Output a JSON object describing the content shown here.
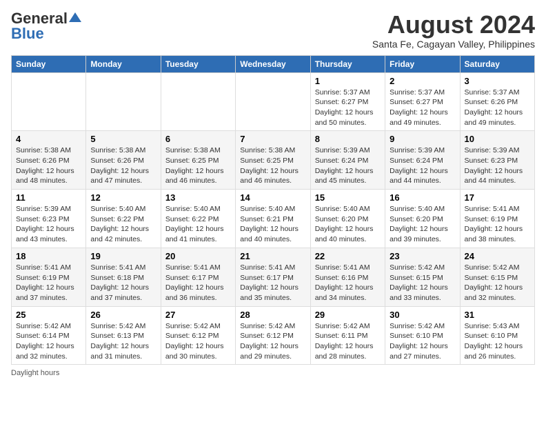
{
  "header": {
    "logo_general": "General",
    "logo_blue": "Blue",
    "month_title": "August 2024",
    "location": "Santa Fe, Cagayan Valley, Philippines"
  },
  "days_of_week": [
    "Sunday",
    "Monday",
    "Tuesday",
    "Wednesday",
    "Thursday",
    "Friday",
    "Saturday"
  ],
  "footer": {
    "daylight_hours": "Daylight hours"
  },
  "weeks": [
    [
      {
        "day": "",
        "info": ""
      },
      {
        "day": "",
        "info": ""
      },
      {
        "day": "",
        "info": ""
      },
      {
        "day": "",
        "info": ""
      },
      {
        "day": "1",
        "info": "Sunrise: 5:37 AM\nSunset: 6:27 PM\nDaylight: 12 hours\nand 50 minutes."
      },
      {
        "day": "2",
        "info": "Sunrise: 5:37 AM\nSunset: 6:27 PM\nDaylight: 12 hours\nand 49 minutes."
      },
      {
        "day": "3",
        "info": "Sunrise: 5:37 AM\nSunset: 6:26 PM\nDaylight: 12 hours\nand 49 minutes."
      }
    ],
    [
      {
        "day": "4",
        "info": "Sunrise: 5:38 AM\nSunset: 6:26 PM\nDaylight: 12 hours\nand 48 minutes."
      },
      {
        "day": "5",
        "info": "Sunrise: 5:38 AM\nSunset: 6:26 PM\nDaylight: 12 hours\nand 47 minutes."
      },
      {
        "day": "6",
        "info": "Sunrise: 5:38 AM\nSunset: 6:25 PM\nDaylight: 12 hours\nand 46 minutes."
      },
      {
        "day": "7",
        "info": "Sunrise: 5:38 AM\nSunset: 6:25 PM\nDaylight: 12 hours\nand 46 minutes."
      },
      {
        "day": "8",
        "info": "Sunrise: 5:39 AM\nSunset: 6:24 PM\nDaylight: 12 hours\nand 45 minutes."
      },
      {
        "day": "9",
        "info": "Sunrise: 5:39 AM\nSunset: 6:24 PM\nDaylight: 12 hours\nand 44 minutes."
      },
      {
        "day": "10",
        "info": "Sunrise: 5:39 AM\nSunset: 6:23 PM\nDaylight: 12 hours\nand 44 minutes."
      }
    ],
    [
      {
        "day": "11",
        "info": "Sunrise: 5:39 AM\nSunset: 6:23 PM\nDaylight: 12 hours\nand 43 minutes."
      },
      {
        "day": "12",
        "info": "Sunrise: 5:40 AM\nSunset: 6:22 PM\nDaylight: 12 hours\nand 42 minutes."
      },
      {
        "day": "13",
        "info": "Sunrise: 5:40 AM\nSunset: 6:22 PM\nDaylight: 12 hours\nand 41 minutes."
      },
      {
        "day": "14",
        "info": "Sunrise: 5:40 AM\nSunset: 6:21 PM\nDaylight: 12 hours\nand 40 minutes."
      },
      {
        "day": "15",
        "info": "Sunrise: 5:40 AM\nSunset: 6:20 PM\nDaylight: 12 hours\nand 40 minutes."
      },
      {
        "day": "16",
        "info": "Sunrise: 5:40 AM\nSunset: 6:20 PM\nDaylight: 12 hours\nand 39 minutes."
      },
      {
        "day": "17",
        "info": "Sunrise: 5:41 AM\nSunset: 6:19 PM\nDaylight: 12 hours\nand 38 minutes."
      }
    ],
    [
      {
        "day": "18",
        "info": "Sunrise: 5:41 AM\nSunset: 6:19 PM\nDaylight: 12 hours\nand 37 minutes."
      },
      {
        "day": "19",
        "info": "Sunrise: 5:41 AM\nSunset: 6:18 PM\nDaylight: 12 hours\nand 37 minutes."
      },
      {
        "day": "20",
        "info": "Sunrise: 5:41 AM\nSunset: 6:17 PM\nDaylight: 12 hours\nand 36 minutes."
      },
      {
        "day": "21",
        "info": "Sunrise: 5:41 AM\nSunset: 6:17 PM\nDaylight: 12 hours\nand 35 minutes."
      },
      {
        "day": "22",
        "info": "Sunrise: 5:41 AM\nSunset: 6:16 PM\nDaylight: 12 hours\nand 34 minutes."
      },
      {
        "day": "23",
        "info": "Sunrise: 5:42 AM\nSunset: 6:15 PM\nDaylight: 12 hours\nand 33 minutes."
      },
      {
        "day": "24",
        "info": "Sunrise: 5:42 AM\nSunset: 6:15 PM\nDaylight: 12 hours\nand 32 minutes."
      }
    ],
    [
      {
        "day": "25",
        "info": "Sunrise: 5:42 AM\nSunset: 6:14 PM\nDaylight: 12 hours\nand 32 minutes."
      },
      {
        "day": "26",
        "info": "Sunrise: 5:42 AM\nSunset: 6:13 PM\nDaylight: 12 hours\nand 31 minutes."
      },
      {
        "day": "27",
        "info": "Sunrise: 5:42 AM\nSunset: 6:12 PM\nDaylight: 12 hours\nand 30 minutes."
      },
      {
        "day": "28",
        "info": "Sunrise: 5:42 AM\nSunset: 6:12 PM\nDaylight: 12 hours\nand 29 minutes."
      },
      {
        "day": "29",
        "info": "Sunrise: 5:42 AM\nSunset: 6:11 PM\nDaylight: 12 hours\nand 28 minutes."
      },
      {
        "day": "30",
        "info": "Sunrise: 5:42 AM\nSunset: 6:10 PM\nDaylight: 12 hours\nand 27 minutes."
      },
      {
        "day": "31",
        "info": "Sunrise: 5:43 AM\nSunset: 6:10 PM\nDaylight: 12 hours\nand 26 minutes."
      }
    ]
  ]
}
